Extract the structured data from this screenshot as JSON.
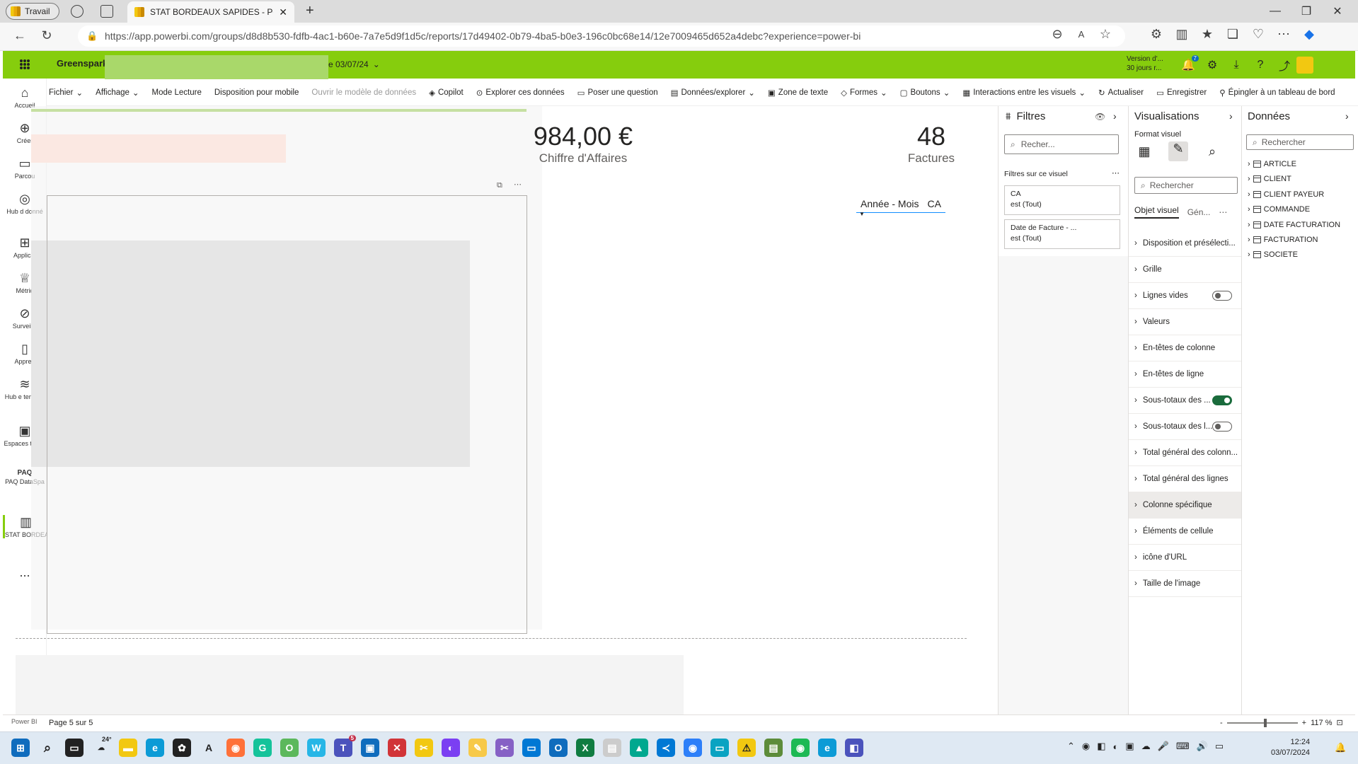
{
  "browser": {
    "profile_label": "Travail",
    "tab_title": "STAT BORDEAUX SAPIDES - Pow",
    "url": "https://app.powerbi.com/groups/d8d8b530-fdfb-4ac1-b60e-7a7e5d9f1d5c/reports/17d49402-0b79-4ba5-b0e3-196c0bc68e14/12e7009465d652a4debc?experience=power-bi",
    "new_tab": "+"
  },
  "header": {
    "workspace": "Greenspark",
    "report_date": "e 03/07/24",
    "version_line1": "Version d'...",
    "version_line2": "30 jours r...",
    "notification_count": "7"
  },
  "ribbon": {
    "items": [
      "Fichier",
      "Affichage",
      "Mode Lecture",
      "Disposition pour mobile",
      "Ouvrir le modèle de données",
      "Copilot",
      "Explorer ces données",
      "Poser une question",
      "Données/explorer",
      "Zone de texte",
      "Formes",
      "Boutons",
      "Interactions entre les visuels",
      "Actualiser",
      "Enregistrer",
      "Épingler à un tableau de bord"
    ]
  },
  "leftnav": {
    "items": [
      "Accueil",
      "Créer",
      "Parcou",
      "Hub d donné",
      "Applicat",
      "Métriq",
      "Surveilla",
      "Appren",
      "Hub e temps r",
      "Espaces travai",
      "PAQ DataSpa",
      "STAT BORDEA"
    ],
    "more": "..."
  },
  "canvas": {
    "kpi1_value": "984,00 €",
    "kpi1_label": "Chiffre d'Affaires",
    "kpi2_value": "48",
    "kpi2_label": "Factures",
    "slicer_label1": "Année - Mois",
    "slicer_label2": "CA"
  },
  "filters": {
    "title": "Filtres",
    "search_placeholder": "Recher...",
    "section": "Filtres sur ce visuel",
    "cards": [
      {
        "name": "CA",
        "value": "est (Tout)"
      },
      {
        "name": "Date de Facture - ...",
        "value": "est (Tout)"
      }
    ]
  },
  "viz": {
    "title": "Visualisations",
    "subtitle": "Format visuel",
    "search_placeholder": "Rechercher",
    "tab_visual": "Objet visuel",
    "tab_general": "Gén...",
    "sections": [
      {
        "label": "Disposition et présélecti...",
        "toggle": null
      },
      {
        "label": "Grille",
        "toggle": null
      },
      {
        "label": "Lignes vides",
        "toggle": "off"
      },
      {
        "label": "Valeurs",
        "toggle": null
      },
      {
        "label": "En-têtes de colonne",
        "toggle": null
      },
      {
        "label": "En-têtes de ligne",
        "toggle": null
      },
      {
        "label": "Sous-totaux des ...",
        "toggle": "on"
      },
      {
        "label": "Sous-totaux des l...",
        "toggle": "off"
      },
      {
        "label": "Total général des colonn...",
        "toggle": null
      },
      {
        "label": "Total général des lignes",
        "toggle": null
      },
      {
        "label": "Colonne spécifique",
        "toggle": null
      },
      {
        "label": "Éléments de cellule",
        "toggle": null
      },
      {
        "label": "icône d'URL",
        "toggle": null
      },
      {
        "label": "Taille de l'image",
        "toggle": null
      }
    ]
  },
  "data_pane": {
    "title": "Données",
    "search_placeholder": "Rechercher",
    "tables": [
      "ARTICLE",
      "CLIENT",
      "CLIENT PAYEUR",
      "COMMANDE",
      "DATE FACTURATION",
      "FACTURATION",
      "SOCIETE"
    ]
  },
  "status": {
    "brand": "Power BI",
    "page": "Page 5 sur 5",
    "zoom": "117 %"
  },
  "taskbar": {
    "temp": "24°",
    "time": "12:24",
    "date": "03/07/2024",
    "teams_badge": "5"
  },
  "colors": {
    "header_green": "#86cd0d",
    "toggle_on": "#1a6b3c"
  }
}
